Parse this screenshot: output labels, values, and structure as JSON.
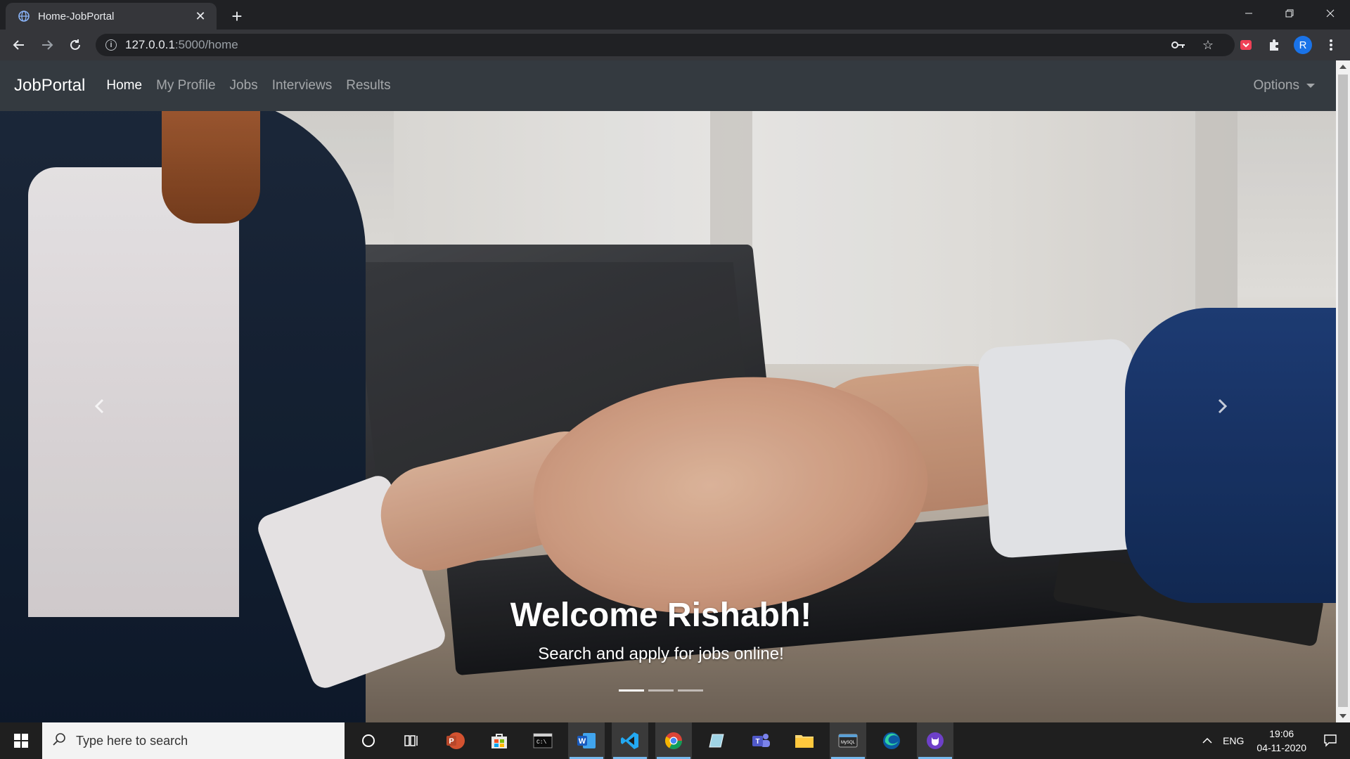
{
  "browser": {
    "tab_title": "Home-JobPortal",
    "url_host": "127.0.0.1",
    "url_path": ":5000/home",
    "profile_initial": "R"
  },
  "navbar": {
    "brand": "JobPortal",
    "links": [
      "Home",
      "My Profile",
      "Jobs",
      "Interviews",
      "Results"
    ],
    "options_label": "Options"
  },
  "hero": {
    "title": "Welcome Rishabh!",
    "subtitle": "Search and apply for jobs online!",
    "slide_count": 3,
    "active_slide": 1
  },
  "taskbar": {
    "search_placeholder": "Type here to search",
    "language": "ENG",
    "time": "19:06",
    "date": "04-11-2020"
  },
  "colors": {
    "navbar_bg": "#343a40",
    "browser_bg": "#202124",
    "tab_bg": "#35363a"
  }
}
